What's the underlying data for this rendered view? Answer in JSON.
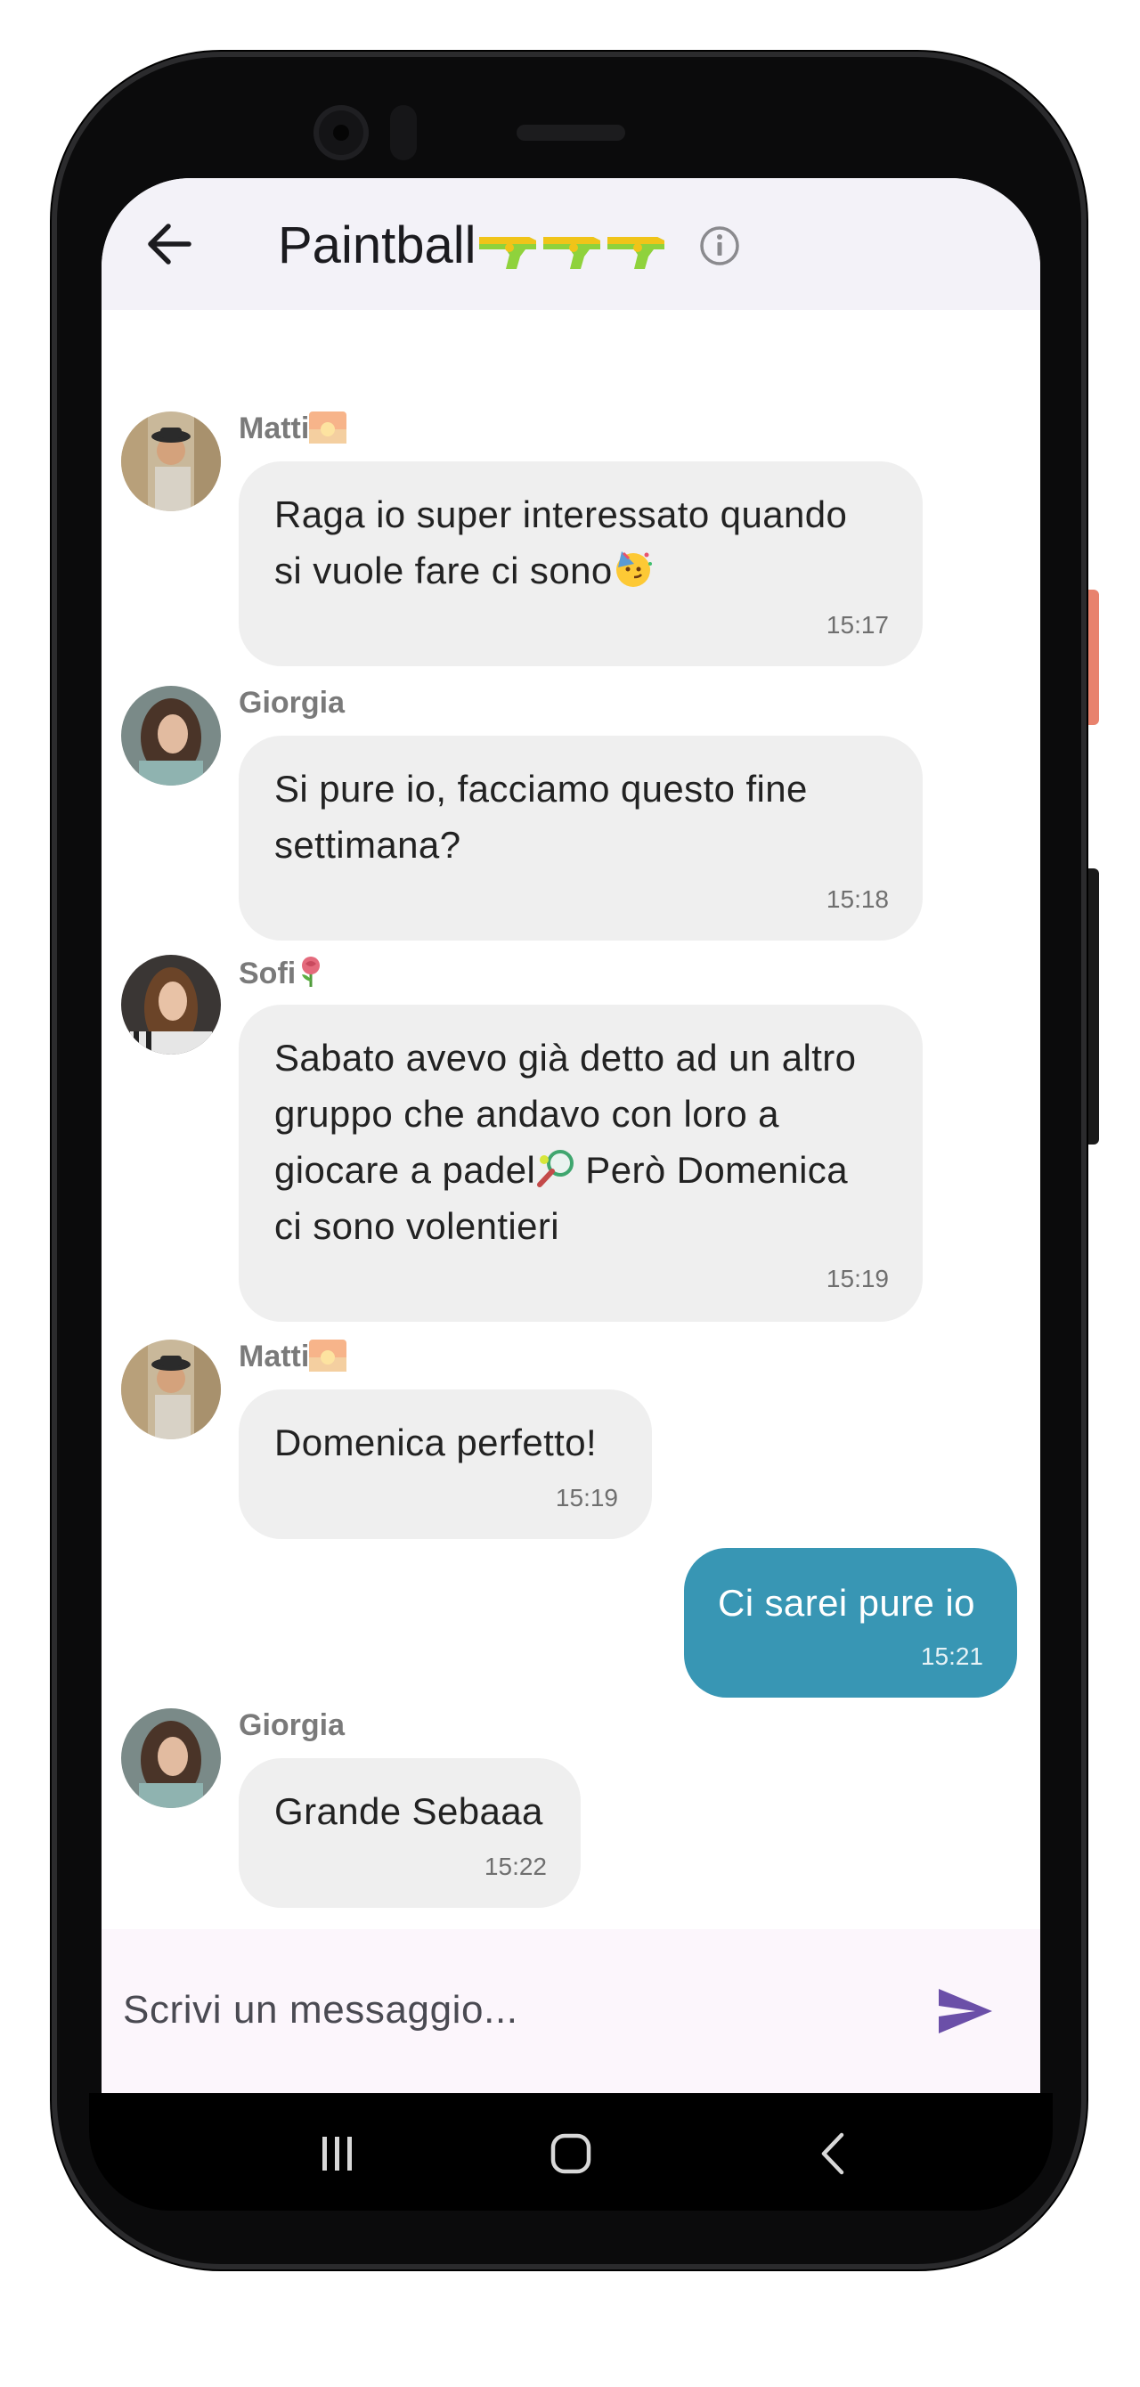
{
  "header": {
    "title": "Paintball",
    "title_emoji": "water-pistol x3"
  },
  "messages": [
    {
      "sender": "Matti",
      "sender_emoji": "sunrise",
      "text": "Raga io super interessato quando\nsi vuole fare ci sono",
      "text_emoji": "partying-face",
      "time": "15:17",
      "mine": false
    },
    {
      "sender": "Giorgia",
      "text": "Si pure io, facciamo questo fine\nsettimana?",
      "time": "15:18",
      "mine": false
    },
    {
      "sender": "Sofi",
      "sender_emoji": "rose",
      "text_a": "Sabato avevo già detto ad un altro\ngruppo che andavo con loro a\ngiocare a padel",
      "text_b": " Però Domenica\nci sono volentieri",
      "text_emoji": "tennis-racket",
      "time": "15:19",
      "mine": false
    },
    {
      "sender": "Matti",
      "sender_emoji": "sunrise",
      "text": "Domenica perfetto!",
      "time": "15:19",
      "mine": false
    },
    {
      "text": "Ci sarei pure io",
      "time": "15:21",
      "mine": true
    },
    {
      "sender": "Giorgia",
      "text": "Grande Sebaaa",
      "time": "15:22",
      "mine": false
    }
  ],
  "input": {
    "placeholder": "Scrivi un messaggio..."
  },
  "colors": {
    "appbar_bg": "#f3f2f8",
    "bubble_other": "#efefef",
    "bubble_mine": "#3896b4",
    "send_icon": "#6b4fa8",
    "input_bg": "#fcf6fc"
  },
  "icons": {
    "back": "arrow-left-icon",
    "info": "info-circle-icon",
    "send": "send-icon",
    "nav_recents": "recents-icon",
    "nav_home": "home-icon",
    "nav_back": "chevron-left-icon"
  }
}
